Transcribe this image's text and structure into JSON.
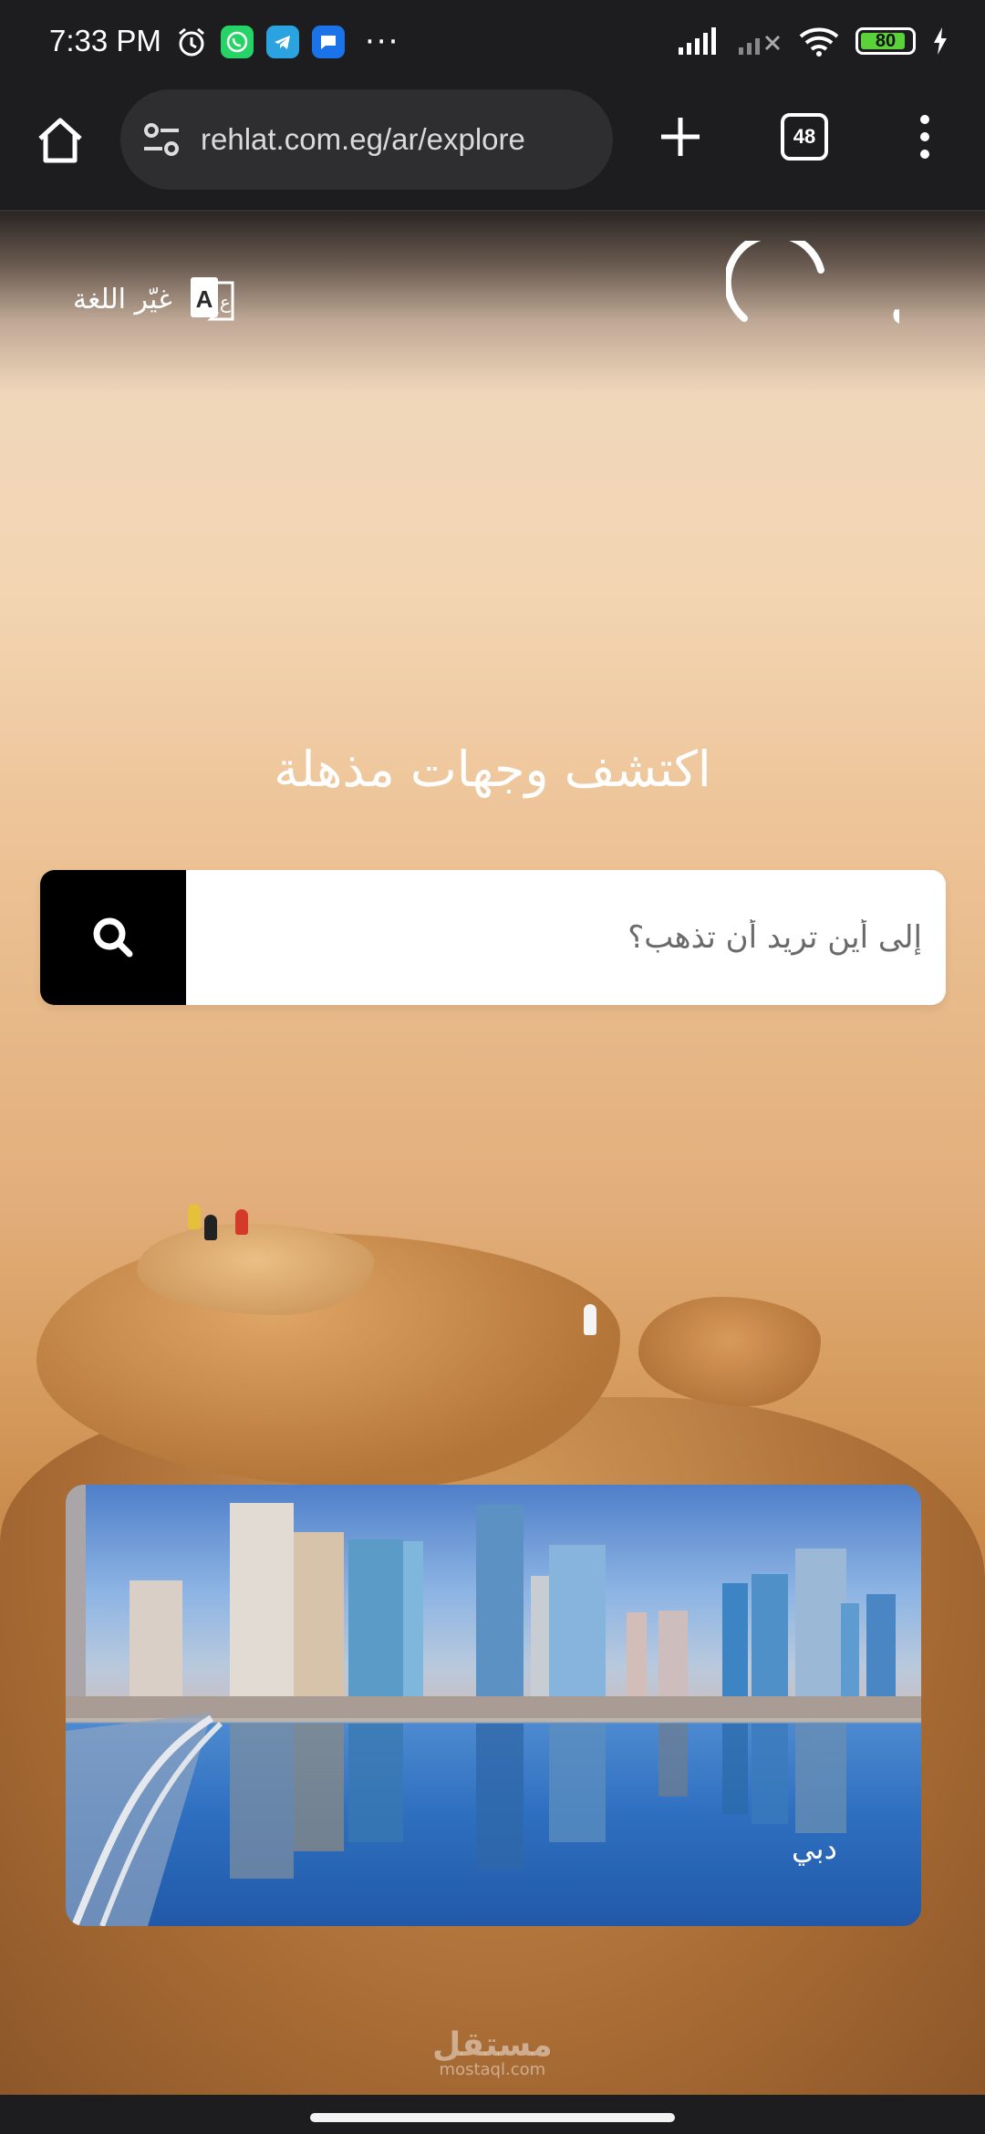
{
  "status_bar": {
    "time": "7:33 PM",
    "battery": "80",
    "icons": [
      "alarm-icon",
      "whatsapp-icon",
      "telegram-icon",
      "messages-icon",
      "more-dots-icon",
      "signal-icon",
      "signal-off-icon",
      "wifi-icon",
      "battery-icon",
      "charging-icon"
    ]
  },
  "browser": {
    "url": "rehlat.com.eg/ar/explore",
    "tab_count": "48"
  },
  "header": {
    "logo_text": "رحلات",
    "language_label": "غيّر اللغة"
  },
  "hero": {
    "headline": "اكتشف وجهات مذهلة"
  },
  "search": {
    "placeholder": "إلى أين تريد أن تذهب؟"
  },
  "destinations": [
    {
      "name": "دبي"
    }
  ],
  "watermark": {
    "text": "مستقل",
    "sub": "mostaql.com"
  },
  "colors": {
    "search_button": "#000000",
    "status_bar_bg": "#1d1d1f",
    "battery_fill": "#5bd13a"
  }
}
